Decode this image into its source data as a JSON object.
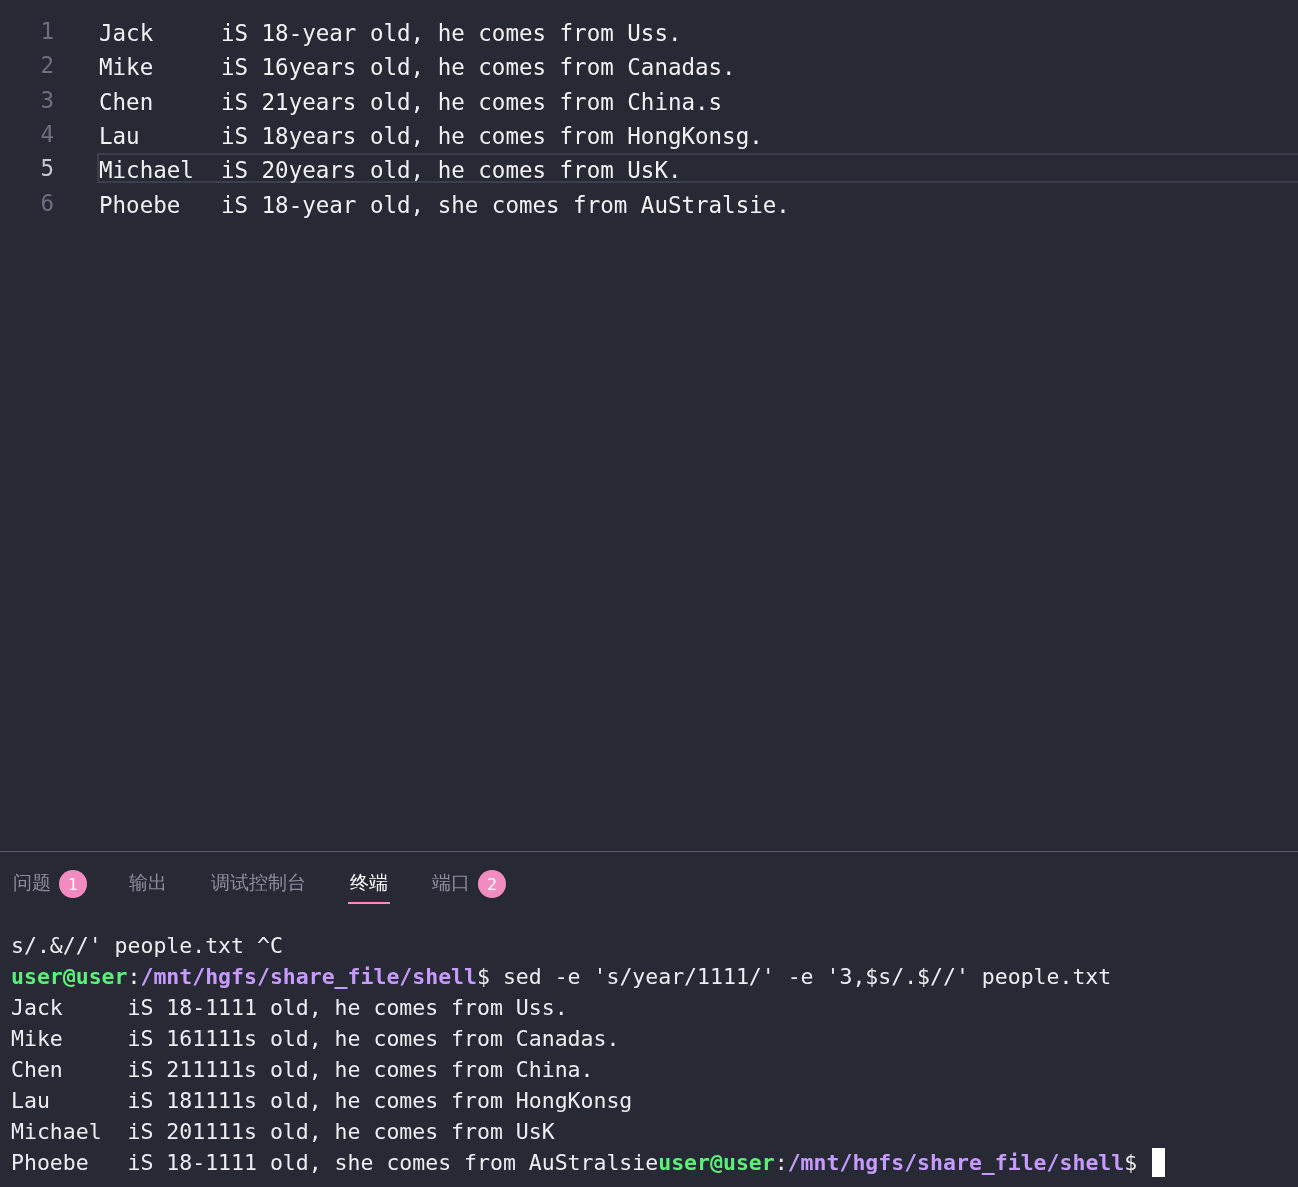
{
  "editor": {
    "lines": [
      {
        "number": "1",
        "text": "Jack     iS 18-year old, he comes from Uss.",
        "current": false
      },
      {
        "number": "2",
        "text": "Mike     iS 16years old, he comes from Canadas.",
        "current": false
      },
      {
        "number": "3",
        "text": "Chen     iS 21years old, he comes from China.s",
        "current": false
      },
      {
        "number": "4",
        "text": "Lau      iS 18years old, he comes from HongKonsg.",
        "current": false
      },
      {
        "number": "5",
        "text": "Michael  iS 20years old, he comes from UsK.",
        "current": true
      },
      {
        "number": "6",
        "text": "Phoebe   iS 18-year old, she comes from AuStralsie.",
        "current": false
      }
    ]
  },
  "panel": {
    "tabs": [
      {
        "label": "问题",
        "badge": "1",
        "selected": false
      },
      {
        "label": "输出",
        "selected": false
      },
      {
        "label": "调试控制台",
        "selected": false
      },
      {
        "label": "终端",
        "selected": true
      },
      {
        "label": "端口",
        "badge": "2",
        "selected": false
      }
    ]
  },
  "terminal": {
    "cursor": true,
    "lines": [
      {
        "segments": [
          {
            "kind": "text",
            "text": "s/.&//' people.txt ^C"
          }
        ]
      },
      {
        "segments": [
          {
            "kind": "user",
            "text": "user@user"
          },
          {
            "kind": "text",
            "text": ":"
          },
          {
            "kind": "path",
            "text": "/mnt/hgfs/share_file/shell"
          },
          {
            "kind": "text",
            "text": "$ sed -e 's/year/1111/' -e '3,$s/.$//' people.txt"
          }
        ]
      },
      {
        "segments": [
          {
            "kind": "text",
            "text": "Jack     iS 18-1111 old, he comes from Uss."
          }
        ]
      },
      {
        "segments": [
          {
            "kind": "text",
            "text": "Mike     iS 161111s old, he comes from Canadas."
          }
        ]
      },
      {
        "segments": [
          {
            "kind": "text",
            "text": "Chen     iS 211111s old, he comes from China."
          }
        ]
      },
      {
        "segments": [
          {
            "kind": "text",
            "text": "Lau      iS 181111s old, he comes from HongKonsg"
          }
        ]
      },
      {
        "segments": [
          {
            "kind": "text",
            "text": "Michael  iS 201111s old, he comes from UsK"
          }
        ]
      },
      {
        "segments": [
          {
            "kind": "text",
            "text": "Phoebe   iS 18-1111 old, she comes from AuStralsie"
          },
          {
            "kind": "user",
            "text": "user@user"
          },
          {
            "kind": "text",
            "text": ":"
          },
          {
            "kind": "path",
            "text": "/mnt/hgfs/share_file/shell"
          },
          {
            "kind": "text",
            "text": "$ "
          }
        ]
      }
    ]
  }
}
